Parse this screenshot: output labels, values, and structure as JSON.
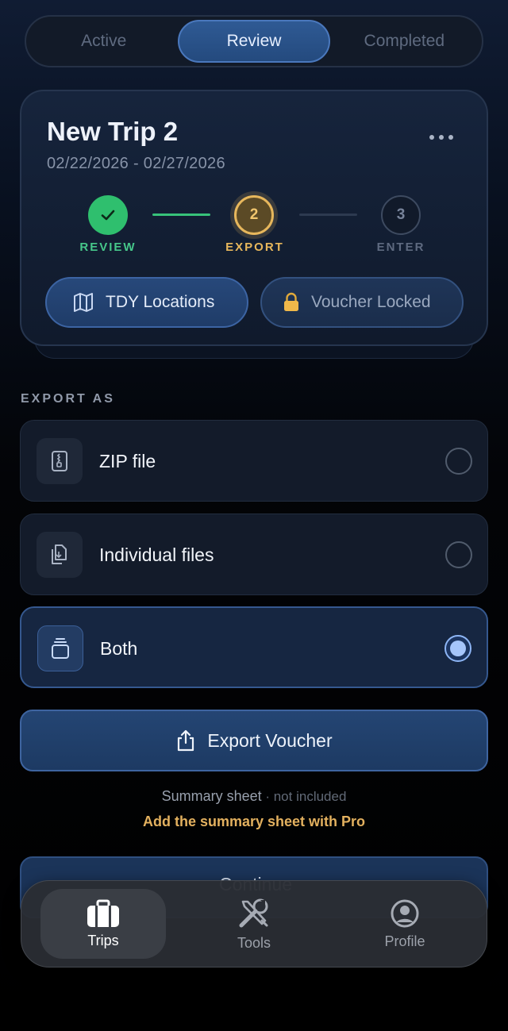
{
  "segmented_control": {
    "tabs": [
      {
        "label": "Active",
        "selected": false
      },
      {
        "label": "Review",
        "selected": true
      },
      {
        "label": "Completed",
        "selected": false
      }
    ]
  },
  "trip_card": {
    "title": "New Trip 2",
    "dates": "02/22/2026 - 02/27/2026",
    "more_icon": "ellipsis-icon",
    "steps": [
      {
        "number": "1",
        "label": "REVIEW",
        "state": "complete"
      },
      {
        "number": "2",
        "label": "EXPORT",
        "state": "current"
      },
      {
        "number": "3",
        "label": "ENTER",
        "state": "pending"
      }
    ],
    "locations_button": {
      "label": "TDY Locations",
      "icon": "map-icon"
    },
    "voucher_button": {
      "label": "Voucher Locked",
      "icon": "lock-icon"
    }
  },
  "export": {
    "section_label": "EXPORT AS",
    "options": [
      {
        "label": "ZIP file",
        "icon": "zip-file-icon",
        "selected": false
      },
      {
        "label": "Individual files",
        "icon": "files-icon",
        "selected": false
      },
      {
        "label": "Both",
        "icon": "stack-icon",
        "selected": true
      }
    ],
    "export_button": {
      "label": "Export Voucher",
      "icon": "share-icon"
    },
    "summary_sheet": "Summary sheet",
    "summary_status": " · not included",
    "pro_link": "Add the summary sheet with Pro",
    "continue_button": {
      "label": "Continue"
    }
  },
  "tab_bar": {
    "tabs": [
      {
        "label": "Trips",
        "icon": "briefcase-icon",
        "selected": true
      },
      {
        "label": "Tools",
        "icon": "tools-icon",
        "selected": false
      },
      {
        "label": "Profile",
        "icon": "profile-icon",
        "selected": false
      }
    ]
  },
  "colors": {
    "accent": "#2f5a94",
    "success": "#2fbf6e",
    "warning": "#e7b75c"
  }
}
